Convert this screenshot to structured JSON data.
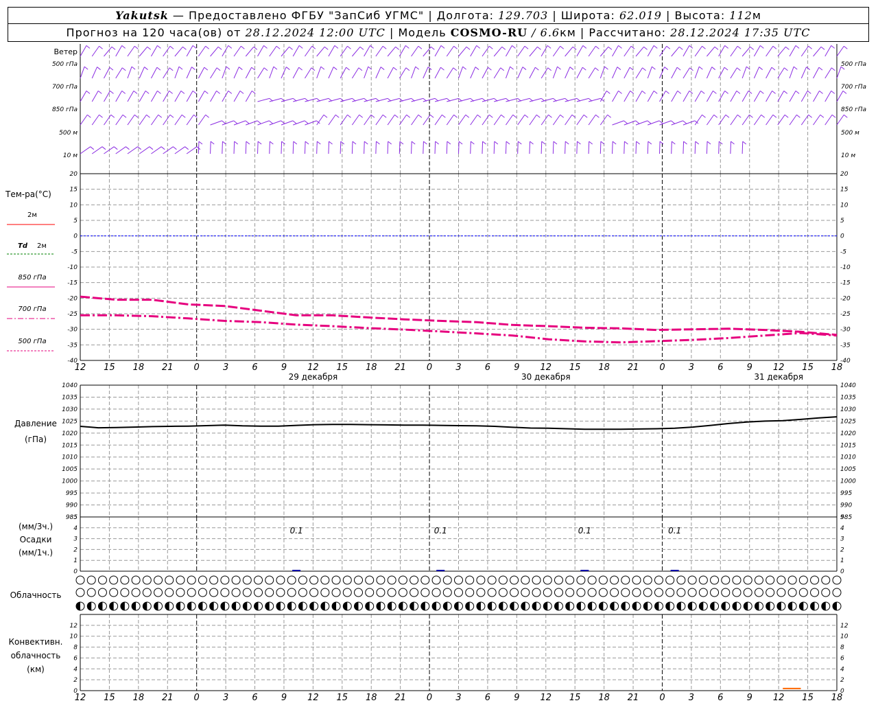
{
  "header": {
    "station": "Yakutsk",
    "provider": "— Предоставлено ФГБУ \"ЗапСиб УГМС\" |",
    "lon_label": "Долгота:",
    "lon_value": "129.703",
    "lat_label": "| Широта:",
    "lat_value": "62.019",
    "alt_label": "| Высота:",
    "alt_value": "112",
    "alt_unit": "м",
    "forecast_label": "Прогноз на 120 часа(ов) от",
    "forecast_time": "28.12.2024 12:00 UTC",
    "model_label": "| Модель",
    "model_name": "COSMO-RU",
    "model_res": "/ 6.6",
    "model_res_unit": "км",
    "computed_label": "| Рассчитано:",
    "computed_time": "28.12.2024 17:35 UTC"
  },
  "time_axis": {
    "hours": [
      "12",
      "15",
      "18",
      "21",
      "0",
      "3",
      "6",
      "9",
      "12",
      "15",
      "18",
      "21",
      "0",
      "3",
      "6",
      "9",
      "12",
      "15",
      "18",
      "21",
      "0",
      "3",
      "6",
      "9",
      "12",
      "15",
      "18"
    ],
    "day_labels": [
      {
        "text": "29 декабря",
        "index": 8
      },
      {
        "text": "30 декабря",
        "index": 16
      },
      {
        "text": "31 декабря",
        "index": 24
      }
    ],
    "midnight_indices": [
      4,
      12,
      20
    ]
  },
  "labels": {
    "wind_title": "Ветер",
    "wind_levels": [
      "500 гПа",
      "700 гПа",
      "850 гПа",
      "500 м",
      "10  м"
    ],
    "temp_title": "Тем-ра(°C)",
    "legend_2m": "2м",
    "legend_td": "Td",
    "legend_td_suffix": "2м",
    "legend_850": "850 гПа",
    "legend_700": "700 гПа",
    "legend_500": "500 гПа",
    "pressure_title": "Давление",
    "pressure_unit": "(гПа)",
    "precip_unit3": "(мм/3ч.)",
    "precip_title": "Осадки",
    "precip_unit1": "(мм/1ч.)",
    "cloud_title": "Облачность",
    "conv_title1": "Конвективн.",
    "conv_title2": "облачность",
    "conv_unit": "(км)"
  },
  "colors": {
    "wind": "#8a2be2",
    "temp": "#e6007e",
    "t2m": "#ff0000",
    "td": "#008000",
    "zero": "#0000ff",
    "grid": "#999999",
    "conv": "#ff6600"
  },
  "chart_data": [
    {
      "type": "line",
      "name": "wind-barbs",
      "levels": [
        "500 гПа",
        "700 гПа",
        "850 гПа",
        "500 м",
        "10  м"
      ],
      "x_range_hours": [
        0,
        126
      ]
    },
    {
      "type": "line",
      "name": "temperature",
      "ylim": [
        -40,
        20
      ],
      "yticks": [
        20,
        15,
        10,
        5,
        0,
        -5,
        -10,
        -15,
        -20,
        -25,
        -30,
        -35,
        -40
      ],
      "series": [
        {
          "name": "850 гПа",
          "x": [
            0,
            6,
            12,
            18,
            24,
            30,
            36,
            42,
            48,
            54,
            60,
            66,
            72,
            78,
            84,
            90,
            96,
            102,
            108,
            114,
            120,
            126
          ],
          "values": [
            -19.5,
            -20.5,
            -20.5,
            -22,
            -22.5,
            -24,
            -25.5,
            -25.5,
            -26.2,
            -26.8,
            -27.3,
            -27.7,
            -28.6,
            -29.0,
            -29.5,
            -29.7,
            -30.2,
            -30.0,
            -29.8,
            -30.2,
            -30.8,
            -31.8
          ]
        },
        {
          "name": "700 гПа",
          "x": [
            0,
            6,
            12,
            18,
            24,
            30,
            36,
            42,
            48,
            54,
            60,
            66,
            72,
            78,
            84,
            90,
            96,
            102,
            108,
            114,
            120,
            126
          ],
          "values": [
            -25.5,
            -25.5,
            -25.8,
            -26.5,
            -27.3,
            -27.7,
            -28.5,
            -29.0,
            -29.6,
            -30.1,
            -30.7,
            -31.3,
            -32.0,
            -33.2,
            -33.9,
            -34.2,
            -33.8,
            -33.4,
            -32.8,
            -32.0,
            -31.2,
            -32.0
          ]
        }
      ]
    },
    {
      "type": "line",
      "name": "pressure",
      "ylim": [
        985,
        1040
      ],
      "yticks": [
        1040,
        1035,
        1030,
        1025,
        1020,
        1015,
        1010,
        1005,
        1000,
        995,
        990,
        985
      ],
      "x": [
        0,
        3,
        6,
        9,
        12,
        15,
        18,
        21,
        24,
        27,
        30,
        33,
        36,
        39,
        42,
        45,
        48,
        51,
        54,
        57,
        60,
        63,
        66,
        69,
        72,
        75,
        78,
        81,
        84,
        87,
        90,
        93,
        96,
        99,
        102,
        105,
        108,
        111,
        114,
        117,
        120,
        123,
        126
      ],
      "values": [
        1022.8,
        1022.2,
        1022.3,
        1022.5,
        1022.7,
        1022.8,
        1022.9,
        1023.1,
        1023.3,
        1023.0,
        1022.9,
        1022.9,
        1023.2,
        1023.5,
        1023.6,
        1023.6,
        1023.5,
        1023.4,
        1023.3,
        1023.3,
        1023.2,
        1023.1,
        1023.0,
        1022.8,
        1022.4,
        1022.1,
        1022.0,
        1021.8,
        1021.6,
        1021.6,
        1021.6,
        1021.7,
        1021.8,
        1022.0,
        1022.5,
        1023.2,
        1024.0,
        1024.6,
        1025.0,
        1025.2,
        1025.7,
        1026.3,
        1026.8
      ]
    },
    {
      "type": "bar",
      "name": "precipitation",
      "ylim": [
        0,
        5
      ],
      "yticks": [
        5,
        4,
        3,
        2,
        1,
        0
      ],
      "annotations": [
        {
          "x": 36,
          "text": "0.1"
        },
        {
          "x": 60,
          "text": "0.1"
        },
        {
          "x": 84,
          "text": "0.1"
        },
        {
          "x": 99,
          "text": "0.1"
        }
      ]
    },
    {
      "type": "bar",
      "name": "convective-cloud",
      "ylim": [
        0,
        14
      ],
      "yticks": [
        12,
        10,
        8,
        6,
        4,
        2,
        0
      ],
      "bars": [
        {
          "x_from": 117,
          "x_to": 120,
          "value": 0.4
        }
      ]
    }
  ]
}
